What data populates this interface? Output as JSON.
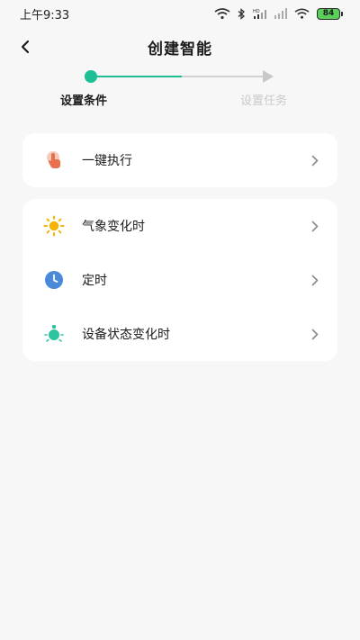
{
  "status_bar": {
    "time": "上午9:33",
    "signal_tag": "HD",
    "battery_level": "84"
  },
  "header": {
    "title": "创建智能",
    "back_icon": "back-arrow-icon"
  },
  "stepper": {
    "steps": [
      {
        "label": "设置条件",
        "state": "active"
      },
      {
        "label": "设置任务",
        "state": "inactive"
      }
    ],
    "active_color": "#1fbf95",
    "inactive_color": "#c9c9c9"
  },
  "manual_card": {
    "items": [
      {
        "label": "一键执行",
        "icon": "tap-hand-icon",
        "icon_color": "#e8704f"
      }
    ]
  },
  "conditions_card": {
    "items": [
      {
        "label": "气象变化时",
        "icon": "sun-icon",
        "icon_color": "#f4b400"
      },
      {
        "label": "定时",
        "icon": "clock-icon",
        "icon_color": "#4a8ad8"
      },
      {
        "label": "设备状态变化时",
        "icon": "device-light-icon",
        "icon_color": "#2ec4a0"
      }
    ]
  }
}
